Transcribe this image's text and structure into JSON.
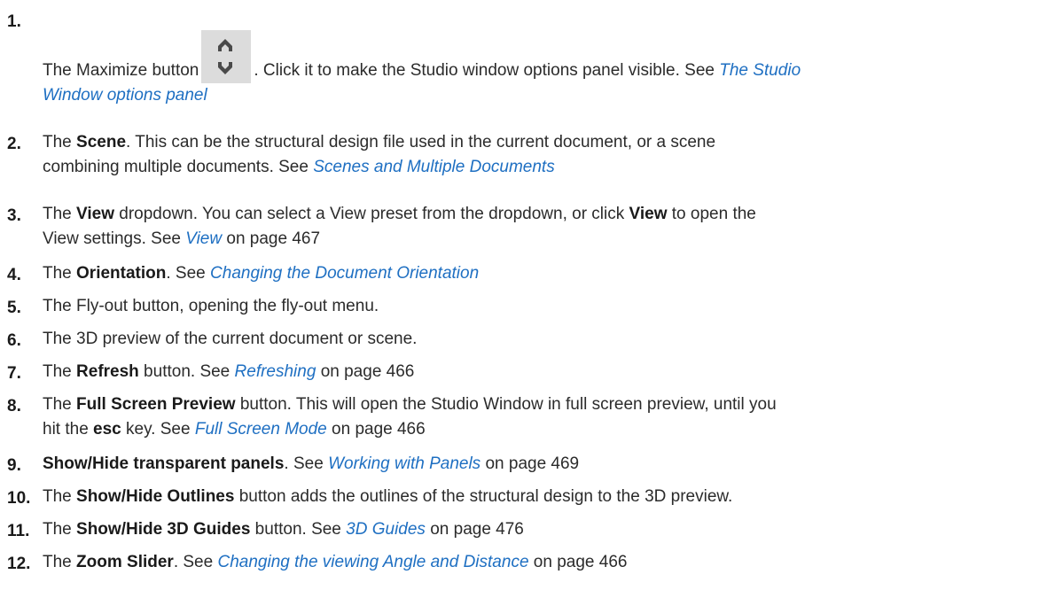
{
  "items": [
    {
      "num": "1.",
      "pre": "The Maximize button",
      "mid": ". Click it to make the Studio window options panel visible. See ",
      "link": "The Studio",
      "link2": "Window options panel",
      "icon": "maximize-icon"
    },
    {
      "num": "2.",
      "pre": "The ",
      "bold": "Scene",
      "post": ". This can be the structural design file used in the current document, or a scene",
      "line2": "combining multiple documents. See ",
      "link": "Scenes and Multiple Documents"
    },
    {
      "num": "3.",
      "pre": "The ",
      "bold": "View",
      "post": " dropdown. You can select a View preset from the dropdown, or click ",
      "bold2": "View",
      "post2": " to open the",
      "line2": "View settings. See ",
      "link": "View",
      "page": " on page 467"
    },
    {
      "num": "4.",
      "pre": "The ",
      "bold": "Orientation",
      "post": ". See ",
      "link": "Changing the Document Orientation"
    },
    {
      "num": "5.",
      "text": "The Fly-out button, opening the fly-out menu."
    },
    {
      "num": "6.",
      "text": "The 3D preview of the current document or scene."
    },
    {
      "num": "7.",
      "pre": "The ",
      "bold": "Refresh",
      "post": " button. See ",
      "link": "Refreshing",
      "page": " on page 466"
    },
    {
      "num": "8.",
      "pre": "The ",
      "bold": "Full Screen Preview",
      "post": " button. This will open the Studio Window in full screen preview, until you",
      "line2a": "hit the ",
      "bold2": "esc",
      "line2b": " key. See ",
      "link": "Full Screen Mode",
      "page": " on page 466"
    },
    {
      "num": "9.",
      "bold": "Show/Hide transparent panels",
      "post": ". See ",
      "link": "Working with Panels",
      "page": " on page 469"
    },
    {
      "num": "10.",
      "pre": "The ",
      "bold": "Show/Hide Outlines",
      "post": " button adds the outlines of the structural design to the 3D preview."
    },
    {
      "num": "11.",
      "pre": "The ",
      "bold": "Show/Hide 3D Guides",
      "post": " button. See ",
      "link": "3D Guides",
      "page": " on page 476"
    },
    {
      "num": "12.",
      "pre": "The ",
      "bold": "Zoom Slider",
      "post": ". See ",
      "link": "Changing the viewing Angle and Distance",
      "page": " on page 466"
    }
  ],
  "colors": {
    "link": "#1e6fc2",
    "text": "#2b2b2b",
    "button_bg": "#dcdcdc"
  }
}
